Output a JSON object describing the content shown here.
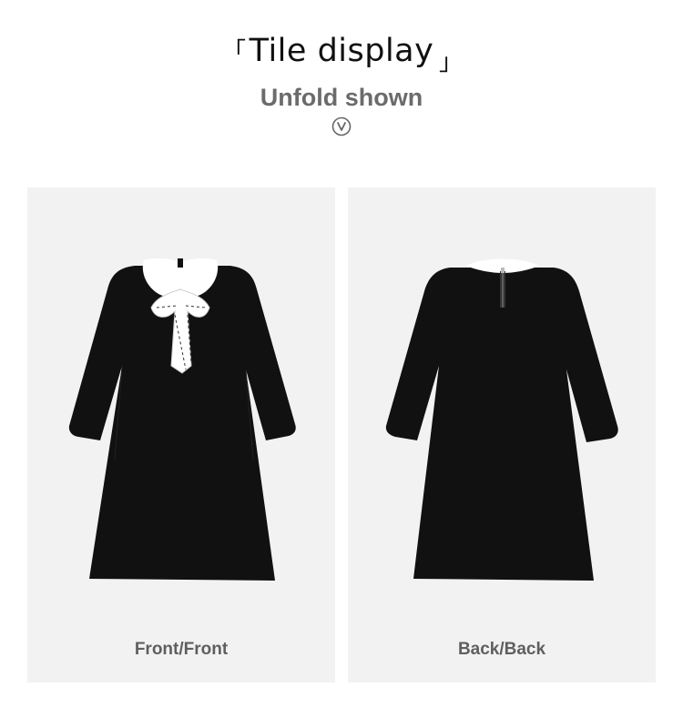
{
  "header": {
    "bracket_open": "「",
    "title": "Tile display",
    "bracket_close": "」",
    "subtitle": "Unfold shown",
    "badge_icon": "circled-v-icon"
  },
  "panels": [
    {
      "label": "Front/Front",
      "image": "dress-front-image"
    },
    {
      "label": "Back/Back",
      "image": "dress-back-image"
    }
  ],
  "colors": {
    "panel_background": "#f2f2f2",
    "dress": "#111111",
    "collar": "#ffffff",
    "subtitle": "#6b6b6b",
    "label": "#5f5f5f"
  }
}
